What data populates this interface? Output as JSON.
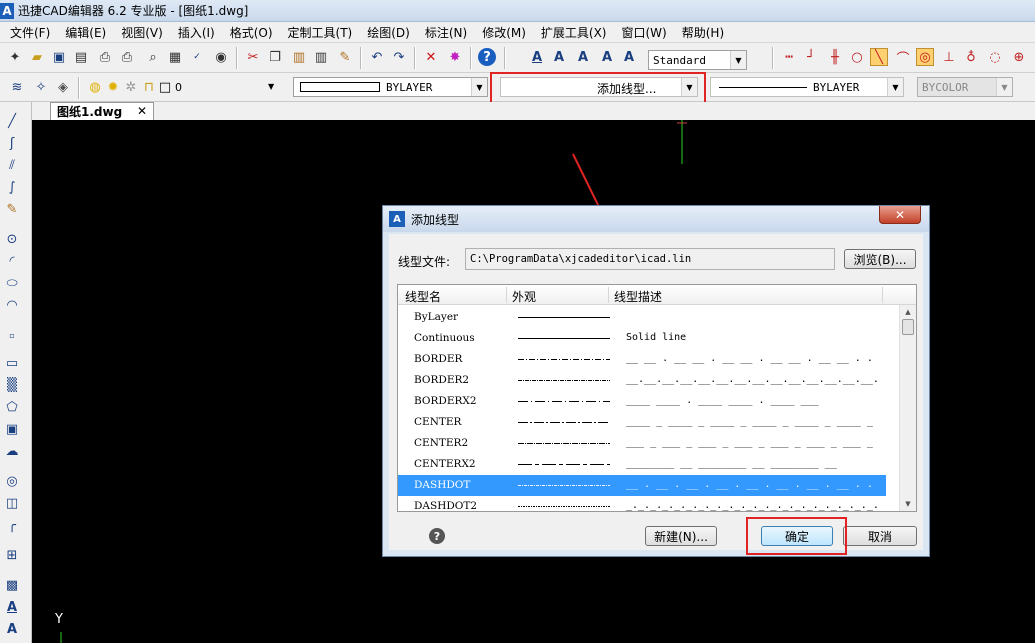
{
  "app": {
    "title": "迅捷CAD编辑器 6.2 专业版  - [图纸1.dwg]",
    "icon_letter": "A"
  },
  "menu": [
    "文件(F)",
    "编辑(E)",
    "视图(V)",
    "插入(I)",
    "格式(O)",
    "定制工具(T)",
    "绘图(D)",
    "标注(N)",
    "修改(M)",
    "扩展工具(X)",
    "窗口(W)",
    "帮助(H)"
  ],
  "toolbar": {
    "text_style": "Standard",
    "layer_value": "0",
    "color_value": "BYLAYER",
    "linetype_value": "添加线型...",
    "lineweight_value": "BYLAYER",
    "plotstyle_value": "BYCOLOR"
  },
  "tab": {
    "label": "图纸1.dwg",
    "close": "✕"
  },
  "canvas": {
    "y_axis_label": "Y"
  },
  "dialog": {
    "title": "添加线型",
    "close": "✕",
    "file_label": "线型文件:",
    "file_path": "C:\\ProgramData\\xjcadeditor\\icad.lin",
    "browse_button": "浏览(B)...",
    "columns": [
      "线型名",
      "外观",
      "线型描述"
    ],
    "rows": [
      {
        "name": "ByLayer",
        "desc": "",
        "dash": "solid"
      },
      {
        "name": "Continuous",
        "desc": "Solid line",
        "dash": "solid"
      },
      {
        "name": "BORDER",
        "desc": "__ __ . __ __ . __ __ . __ __ . __ __ . . .",
        "dash": "6,2,1,2"
      },
      {
        "name": "BORDER2",
        "desc": "__.__.__.__.__.__.__.__.__.__.__.__.__.__.__.",
        "dash": "4,1,1,1"
      },
      {
        "name": "BORDERX2",
        "desc": "____  ____  .  ____  ____  .  ____  ___",
        "dash": "10,3,1,3"
      },
      {
        "name": "CENTER",
        "desc": "____ _ ____ _ ____ _ ____ _ ____ _ ____ _",
        "dash": "10,2,2,2"
      },
      {
        "name": "CENTER2",
        "desc": "___ _ ___ _ ___ _ ___ _ ___ _ ___ _ ___ _",
        "dash": "6,1,1,1"
      },
      {
        "name": "CENTERX2",
        "desc": "________  __  ________  __  ________  __",
        "dash": "14,3,4,3"
      },
      {
        "name": "DASHDOT",
        "desc": "__ . __ . __ . __ . __ . __ . __ . __ . . .",
        "dash": "3,1,1,1"
      },
      {
        "name": "DASHDOT2",
        "desc": "_._._._._._._._._._._._._._._._._._._._._.",
        "dash": "2,1,1,1"
      }
    ],
    "selected_index": 8,
    "new_button": "新建(N)...",
    "ok_button": "确定",
    "cancel_button": "取消",
    "help": "?"
  },
  "colors": {
    "accent_red": "#e02424",
    "selection": "#3399ff"
  }
}
